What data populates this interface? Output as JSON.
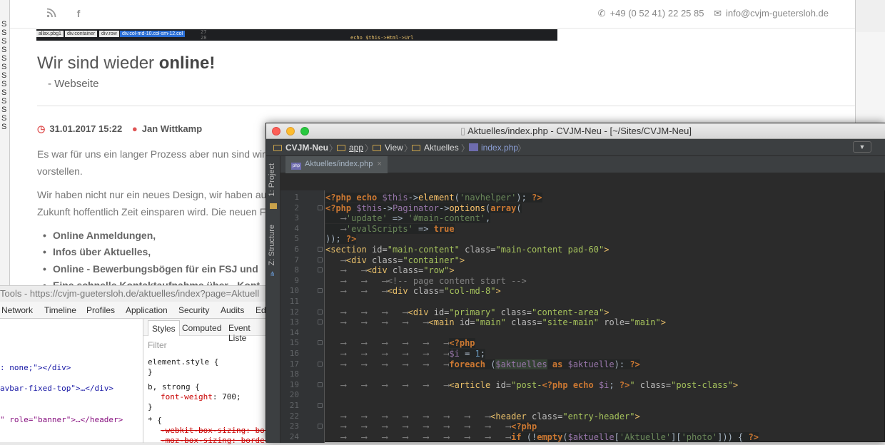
{
  "left_strip_chars": [
    "S",
    "S",
    "S",
    "S",
    "S",
    "S",
    "S",
    "S",
    "S",
    "S",
    "S",
    "S",
    "S"
  ],
  "browser": {
    "contact_phone": "+49 (0 52 41) 22 25 85",
    "contact_email": "info@cvjm-guetersloh.de",
    "inspector_crumbs": [
      "allax.pbg1",
      "div.container",
      "div.row",
      "div.col-md-10.col-sm-12.col"
    ],
    "inspector_lines": [
      "27",
      "28"
    ],
    "inspector_code": "echo $this->Html->Url",
    "title_prefix": "Wir sind wieder ",
    "title_bold": "online!",
    "subtitle": "- Webseite",
    "date": "31.01.2017 15:22",
    "author": "Jan Wittkamp",
    "paragraphs": [
      "Es war für uns ein langer Prozess aber nun sind wir s",
      "vorstellen.",
      "Wir haben nicht nur ein neues Design, wir haben au",
      "Zukunft hoffentlich Zeit einsparen wird. Die neuen F"
    ],
    "bullets": [
      "Online Anmeldungen,",
      "Infos über Aktuelles,",
      "Online - Bewerbungsbögen für ein FSJ und",
      "Eine schnelle Kontaktaufnahme über - Kont"
    ]
  },
  "devtools": {
    "title": "Tools - https://cvjm-guetersloh.de/aktuelles/index?page=Aktuell",
    "tabs": [
      "Network",
      "Timeline",
      "Profiles",
      "Application",
      "Security",
      "Audits",
      "Ed"
    ],
    "elements": [
      ": none;\"></div>",
      "avbar-fixed-top\">…</div>",
      "\" role=\"banner\">…</header>"
    ],
    "subtabs": [
      "Styles",
      "Computed",
      "Event Liste"
    ],
    "filter_placeholder": "Filter",
    "styles": {
      "element_style": "element.style {",
      "close1": "}",
      "rule2_selector": "b, strong {",
      "rule2_prop": "font-weight",
      "rule2_val": "700;",
      "close2": "}",
      "rule3_selector": "* {",
      "rule3_prop1": "-webkit-box-sizing: bor",
      "rule3_prop2": "-moz-box-sizing: border"
    }
  },
  "ide": {
    "window_title": "Aktuelles/index.php - CVJM-Neu - [~/Sites/CVJM-Neu]",
    "breadcrumbs": [
      "CVJM-Neu",
      "app",
      "View",
      "Aktuelles",
      "index.php"
    ],
    "side_tabs": [
      "1: Project",
      "Z: Structure"
    ],
    "file_tab": "Aktuelles/index.php",
    "line_numbers": [
      "1",
      "2",
      "3",
      "4",
      "5",
      "6",
      "7",
      "8",
      "9",
      "10",
      "11",
      "12",
      "13",
      "14",
      "15",
      "16",
      "17",
      "18",
      "19",
      "20",
      "21",
      "22",
      "23",
      "24"
    ]
  }
}
